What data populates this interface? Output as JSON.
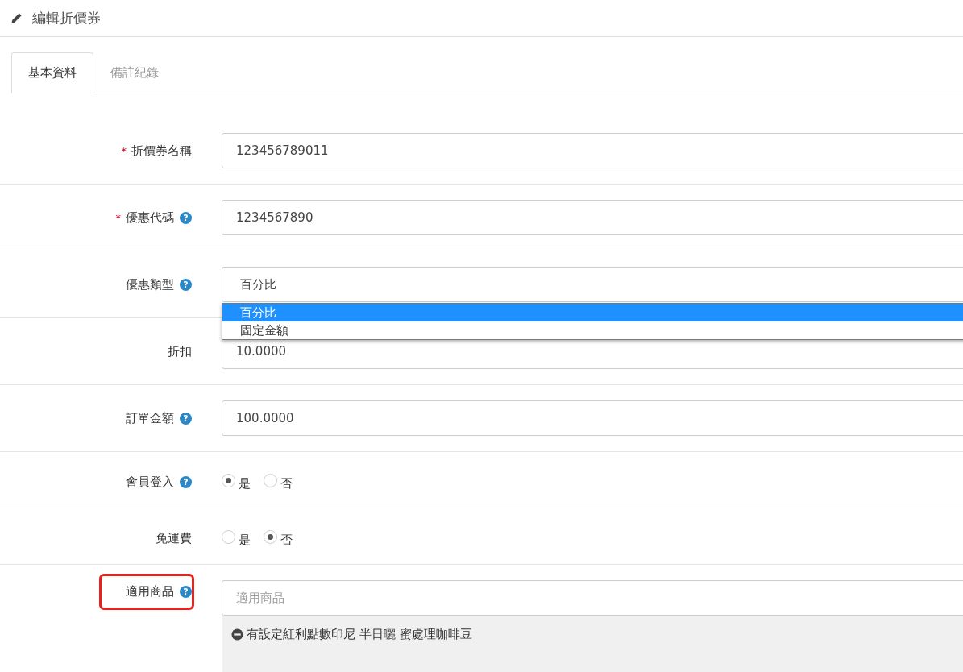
{
  "header": {
    "title": "編輯折價券"
  },
  "tabs": [
    {
      "label": "基本資料",
      "selected": true
    },
    {
      "label": "備註紀錄",
      "selected": false
    }
  ],
  "fields": [
    {
      "kind": "text",
      "label": "折價券名稱",
      "required_mark": "*",
      "value": "123456789011"
    },
    {
      "kind": "text",
      "label": "優惠代碼",
      "required_mark": "*",
      "help": "?",
      "value": "1234567890"
    },
    {
      "kind": "select",
      "label": "優惠類型",
      "help": "?",
      "value": "百分比",
      "expanded": true,
      "options": [
        {
          "label": "百分比",
          "selected": true
        },
        {
          "label": "固定金額",
          "selected": false
        }
      ]
    },
    {
      "kind": "text",
      "label": "折扣",
      "value": "10.0000"
    },
    {
      "kind": "text",
      "label": "訂單金額",
      "help": "?",
      "value": "100.0000"
    },
    {
      "kind": "radio",
      "label": "會員登入",
      "help": "?",
      "options": [
        {
          "label": "是",
          "selected": true
        },
        {
          "label": "否",
          "selected": false
        }
      ]
    },
    {
      "kind": "radio",
      "label": "免運費",
      "options": [
        {
          "label": "是",
          "selected": false
        },
        {
          "label": "否",
          "selected": true
        }
      ]
    },
    {
      "kind": "products",
      "label": "適用商品",
      "help": "?",
      "highlighted": true,
      "placeholder": "適用商品",
      "items": [
        "有設定紅利點數印尼 半日曬 蜜處理咖啡豆"
      ]
    }
  ]
}
